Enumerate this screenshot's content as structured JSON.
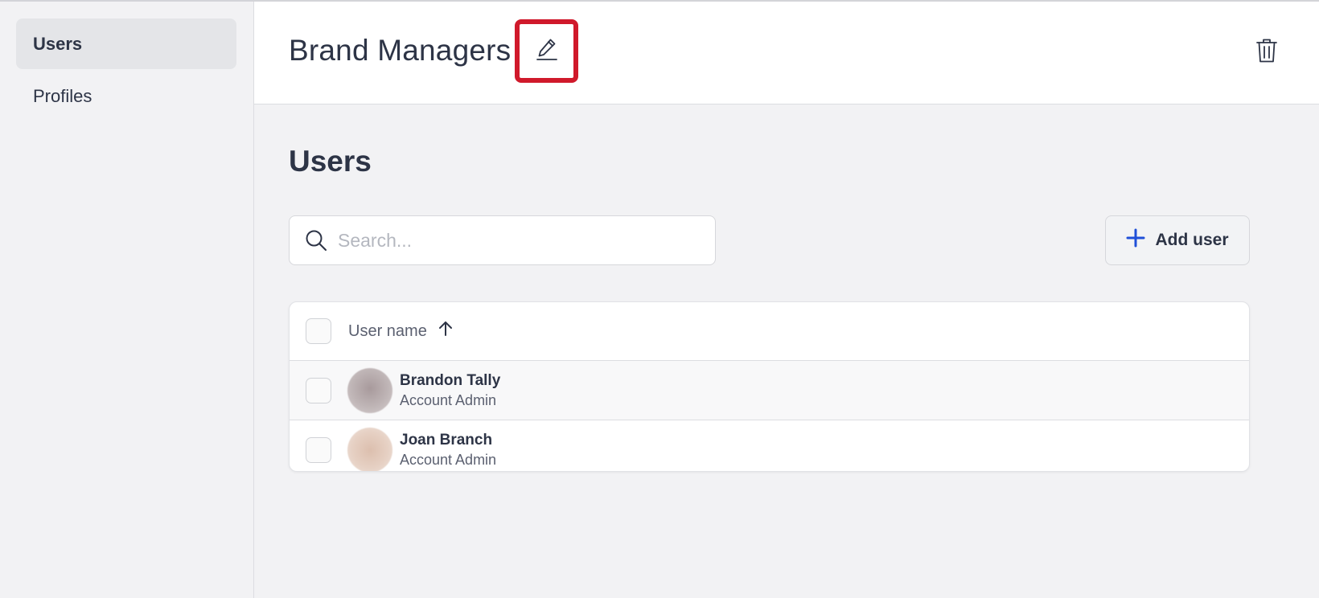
{
  "sidebar": {
    "items": [
      {
        "label": "Users",
        "active": true
      },
      {
        "label": "Profiles",
        "active": false
      }
    ]
  },
  "header": {
    "title": "Brand Managers",
    "edit_icon": "pencil-icon",
    "delete_icon": "trash-icon",
    "highlight_color": "#d0192b"
  },
  "main": {
    "section_title": "Users",
    "search": {
      "placeholder": "Search...",
      "value": "",
      "icon": "search-icon"
    },
    "add_button": {
      "label": "Add user",
      "icon": "plus-icon",
      "icon_color": "#1f4fd8"
    },
    "table": {
      "columns": [
        {
          "label": "User name",
          "sort": "ascending",
          "sort_icon": "arrow-up-icon"
        }
      ],
      "rows": [
        {
          "name": "Brandon Tally",
          "role": "Account Admin",
          "avatar_color": "#b9aeb0"
        },
        {
          "name": "Joan Branch",
          "role": "Account Admin",
          "avatar_color": "#e2cbbd"
        }
      ]
    }
  }
}
